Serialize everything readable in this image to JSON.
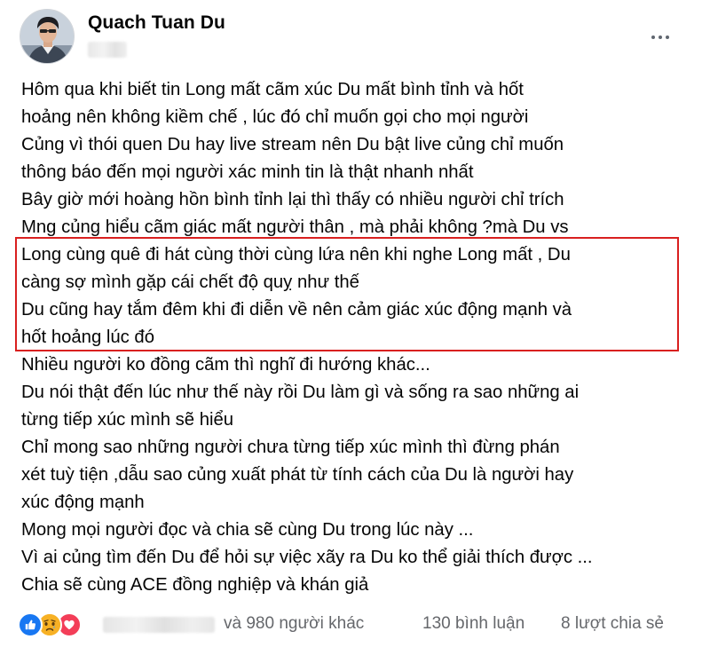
{
  "post": {
    "author": {
      "name": "Quach Tuan Du"
    },
    "more_icon": "more-horizontal-icon",
    "body_lines": [
      "Hôm qua khi biết tin Long mất cãm xúc Du mất bình tỉnh và hốt",
      "hoảng nên không kiềm chế , lúc đó chỉ muốn gọi cho mọi người",
      "Củng vì thói quen Du hay live stream nên Du bật live củng chỉ muốn",
      "thông báo đến mọi người xác minh tin là thật nhanh nhất",
      "Bây giờ mới hoàng hồn bình tỉnh lại thì thấy có nhiều người chỉ trích",
      "Mng củng hiểu cãm giác mất người thân , mà phải không ?mà Du vs",
      "Long cùng quê đi hát cùng thời cùng lứa nên khi nghe Long mất , Du",
      "càng sợ mình gặp cái chết độ quỵ như thế",
      "Du cũng hay tắm đêm khi đi diễn về nên cảm giác xúc động mạnh và",
      "hốt hoảng lúc đó",
      "Nhiều người ko đồng cãm thì nghĩ đi hướng khác...",
      "Du nói thật đến lúc như thế này rồi Du làm gì và sống ra sao những ai",
      "từng tiếp xúc mình sẽ hiểu",
      "Chỉ mong sao những người chưa từng tiếp xúc mình thì đừng phán",
      "xét tuỳ tiện ,dẫu sao củng xuất phát từ tính cách của Du là người hay",
      "xúc động mạnh",
      "Mong mọi người đọc và chia sẽ cùng Du trong lúc này ...",
      "Vì ai củng tìm đến Du để hỏi sự việc xãy ra Du ko thể giải thích được ...",
      "Chia sẽ cùng ACE đồng nghiệp và khán giả"
    ],
    "highlight": {
      "color": "#d9201f"
    },
    "footer": {
      "reactions": [
        "like-icon",
        "sad-icon",
        "love-icon"
      ],
      "others_text": "và 980 người khác",
      "comments_text": "130 bình luận",
      "shares_text": "8 lượt chia sẻ"
    },
    "colors": {
      "like": "#1877f2",
      "sad": "#f7b125",
      "love": "#f33e58",
      "secondary_text": "#65676b"
    }
  }
}
